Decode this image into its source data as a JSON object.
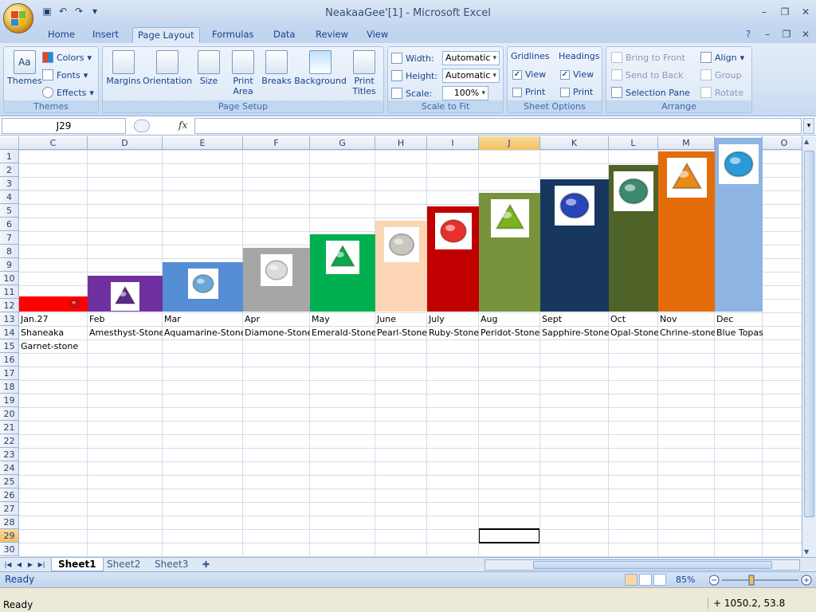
{
  "window": {
    "title": "NeakaaGee'[1] - Microsoft Excel"
  },
  "tabs": [
    "Home",
    "Insert",
    "Page Layout",
    "Formulas",
    "Data",
    "Review",
    "View"
  ],
  "active_tab": "Page Layout",
  "ribbon": {
    "themes": {
      "label": "Themes",
      "colors": "Colors",
      "fonts": "Fonts",
      "effects": "Effects",
      "group": "Themes"
    },
    "page_setup": {
      "margins": "Margins",
      "orientation": "Orientation",
      "size": "Size",
      "print_area_1": "Print",
      "print_area_2": "Area",
      "breaks": "Breaks",
      "background": "Background",
      "print_titles_1": "Print",
      "print_titles_2": "Titles",
      "group": "Page Setup"
    },
    "scale_to_fit": {
      "width_label": "Width:",
      "width_value": "Automatic",
      "height_label": "Height:",
      "height_value": "Automatic",
      "scale_label": "Scale:",
      "scale_value": "100%",
      "group": "Scale to Fit"
    },
    "sheet_options": {
      "gridlines": "Gridlines",
      "headings": "Headings",
      "view": "View",
      "print": "Print",
      "group": "Sheet Options"
    },
    "arrange": {
      "bring_front": "Bring to Front",
      "send_back": "Send to Back",
      "selection_pane": "Selection Pane",
      "align": "Align",
      "group_btn": "Group",
      "rotate": "Rotate",
      "group": "Arrange"
    }
  },
  "formula_bar": {
    "name_box": "J29",
    "fx": "fx",
    "value": ""
  },
  "columns": [
    "C",
    "D",
    "E",
    "F",
    "G",
    "H",
    "I",
    "J",
    "K",
    "L",
    "M",
    "N",
    "O"
  ],
  "selected_column": "J",
  "rows": [
    "1",
    "2",
    "3",
    "4",
    "5",
    "6",
    "7",
    "8",
    "9",
    "10",
    "11",
    "12",
    "13",
    "14",
    "15",
    "16",
    "17",
    "18",
    "19",
    "20",
    "21",
    "22",
    "23",
    "24",
    "25",
    "26",
    "27",
    "28",
    "29",
    "30"
  ],
  "selected_row": "29",
  "months": [
    {
      "month": "Jan.27",
      "stone": "Shaneaka",
      "extra": "Garnet-stone",
      "color": "#ff0000",
      "gem": "#c0181f",
      "level": 1
    },
    {
      "month": "Feb",
      "stone": "Amesthyst-Stone",
      "color": "#7030a0",
      "gem": "#5a2a83",
      "level": 2
    },
    {
      "month": "Mar",
      "stone": "Aquamarine-Stone",
      "color": "#558ed5",
      "gem": "#6aa7d8",
      "level": 3
    },
    {
      "month": "Apr",
      "stone": "Diamone-Stone",
      "color": "#a6a6a6",
      "gem": "#dcdcdc",
      "level": 4
    },
    {
      "month": "May",
      "stone": "Emerald-Stone",
      "color": "#00b050",
      "gem": "#0aa84a",
      "level": 5
    },
    {
      "month": "June",
      "stone": "Pearl-Stone",
      "color": "#fcd5b4",
      "gem": "#c9c6bd",
      "level": 6
    },
    {
      "month": "July",
      "stone": "Ruby-Stone",
      "color": "#c00000",
      "gem": "#e8302c",
      "level": 7
    },
    {
      "month": "Aug",
      "stone": "Peridot-Stone",
      "color": "#77933c",
      "gem": "#7fb31c",
      "level": 8
    },
    {
      "month": "Sept",
      "stone": "Sapphire-Stone",
      "color": "#17375e",
      "gem": "#2846b8",
      "level": 9
    },
    {
      "month": "Oct",
      "stone": "Opal-Stone",
      "color": "#4f6228",
      "gem": "#3c8a6e",
      "level": 10
    },
    {
      "month": "Nov",
      "stone": "Chrine-stone",
      "color": "#e46c0a",
      "gem": "#e88a18",
      "level": 11
    },
    {
      "month": "Dec",
      "stone": "Blue Topas",
      "color": "#8db4e2",
      "gem": "#2a9ad8",
      "level": 12
    }
  ],
  "sheets": [
    "Sheet1",
    "Sheet2",
    "Sheet3"
  ],
  "active_sheet": "Sheet1",
  "status": {
    "ready": "Ready",
    "zoom": "85%"
  },
  "os": {
    "ready": "Ready",
    "coords": "1050.2, 53.8"
  }
}
